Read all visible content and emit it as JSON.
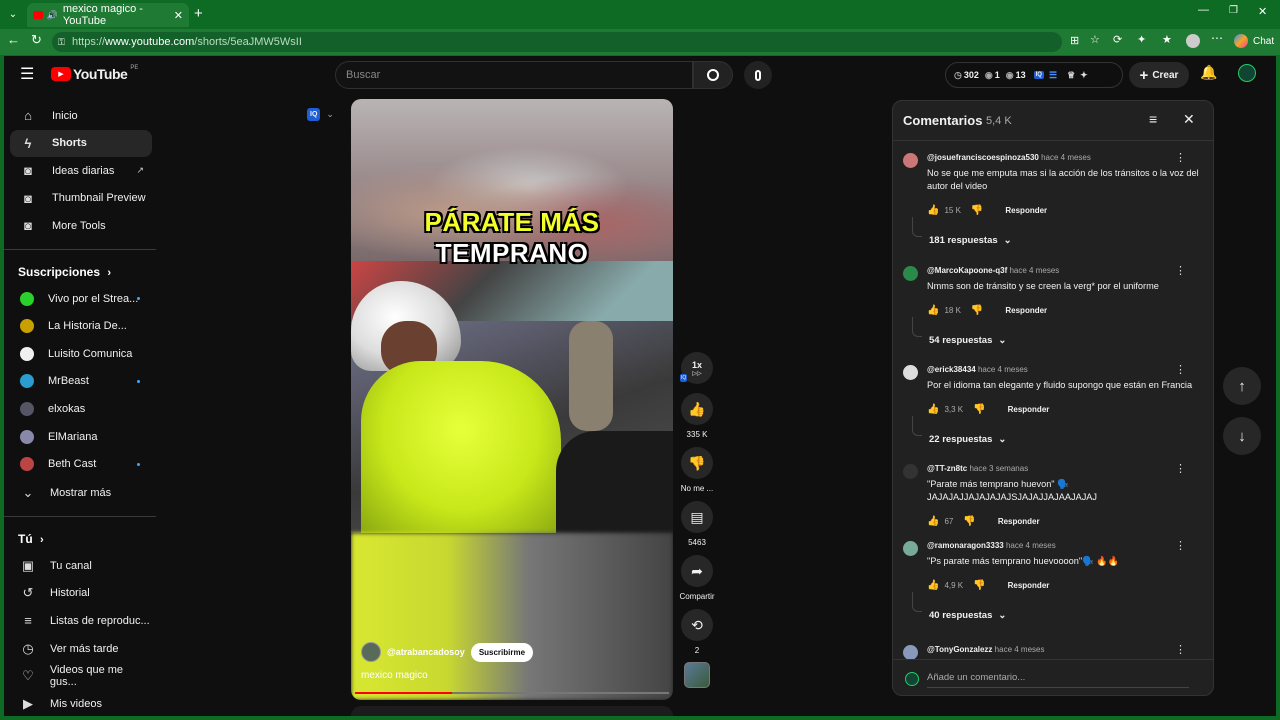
{
  "browser": {
    "tab_title": "mexico magico - YouTube",
    "url_prefix": "https://",
    "url_host": "www.youtube.com",
    "url_path": "/shorts/5eaJMW5WsII",
    "new_tab": "+",
    "chat_label": "Chat"
  },
  "header": {
    "logo": "YouTube",
    "region": "PE",
    "search_placeholder": "Buscar",
    "stats": {
      "views": "302",
      "a": "1",
      "b": "13"
    },
    "create_label": "Crear"
  },
  "sidebar": {
    "main": [
      {
        "label": "Inicio",
        "icon": "home-icon"
      },
      {
        "label": "Shorts",
        "icon": "shorts-icon"
      },
      {
        "label": "Ideas diarias",
        "icon": "iq-icon"
      },
      {
        "label": "Thumbnail Preview",
        "icon": "iq-icon"
      },
      {
        "label": "More Tools",
        "icon": "iq-icon"
      }
    ],
    "subs_title": "Suscripciones",
    "subs": [
      {
        "label": "Vivo por el Strea...",
        "color": "#2bd12b"
      },
      {
        "label": "La Historia De...",
        "color": "#c8a000"
      },
      {
        "label": "Luisito Comunica",
        "color": "#f0f0f0"
      },
      {
        "label": "MrBeast",
        "color": "#2a9ccf"
      },
      {
        "label": "elxokas",
        "color": "#556"
      },
      {
        "label": "ElMariana",
        "color": "#88a"
      },
      {
        "label": "Beth Cast",
        "color": "#b44"
      }
    ],
    "show_more": "Mostrar más",
    "you_title": "Tú",
    "you": [
      {
        "label": "Tu canal",
        "icon": "channel-icon"
      },
      {
        "label": "Historial",
        "icon": "history-icon"
      },
      {
        "label": "Listas de reproduc...",
        "icon": "playlist-icon"
      },
      {
        "label": "Ver más tarde",
        "icon": "clock-icon"
      },
      {
        "label": "Videos que me gus...",
        "icon": "like-icon"
      },
      {
        "label": "Mis videos",
        "icon": "video-icon"
      }
    ]
  },
  "video": {
    "overlay_line1": "PÁRATE MÁS",
    "overlay_line2": "TEMPRANO",
    "channel": "@atrabancadosoy",
    "subscribe": "Suscribirme",
    "title": "mexico magico",
    "speed": "1x",
    "progress": 0.31
  },
  "actions": {
    "likes": "335 K",
    "dislike": "No me ...",
    "comments": "5463",
    "share": "Compartir",
    "remix": "2"
  },
  "comments": {
    "title": "Comentarios",
    "count": "5,4 K",
    "placeholder": "Añade un comentario...",
    "reply_label": "Responder",
    "items": [
      {
        "author": "@josuefranciscoespinoza530",
        "time": "hace 4 meses",
        "text": "No se que me emputa mas si la acción de los tránsitos o la voz del autor del video",
        "likes": "15 K",
        "replies": "181 respuestas",
        "color": "#c77"
      },
      {
        "author": "@MarcoKapoone-q3f",
        "time": "hace 4 meses",
        "text": "Nmms son de tránsito y se creen la verg* por el uniforme",
        "likes": "18 K",
        "replies": "54 respuestas",
        "color": "#2a8a4a"
      },
      {
        "author": "@erick38434",
        "time": "hace 4 meses",
        "text": "Por el idioma tan elegante y fluido supongo que están en Francia",
        "likes": "3,3 K",
        "replies": "22 respuestas",
        "color": "#ddd"
      },
      {
        "author": "@TT-zn8tc",
        "time": "hace 3 semanas",
        "text": "\"Parate más temprano huevon\" 🗣️ JAJAJAJJAJAJAJAJSJAJAJJAJAAJAJAJ",
        "likes": "67",
        "replies": "",
        "color": "#333"
      },
      {
        "author": "@ramonaragon3333",
        "time": "hace 4 meses",
        "text": "\"Ps parate más temprano huevoooon\"🗣️ 🔥🔥",
        "likes": "4,9 K",
        "replies": "40 respuestas",
        "color": "#7a9"
      },
      {
        "author": "@TonyGonzalezz",
        "time": "hace 4 meses",
        "text": "",
        "likes": "",
        "replies": "",
        "color": "#89b"
      }
    ]
  }
}
